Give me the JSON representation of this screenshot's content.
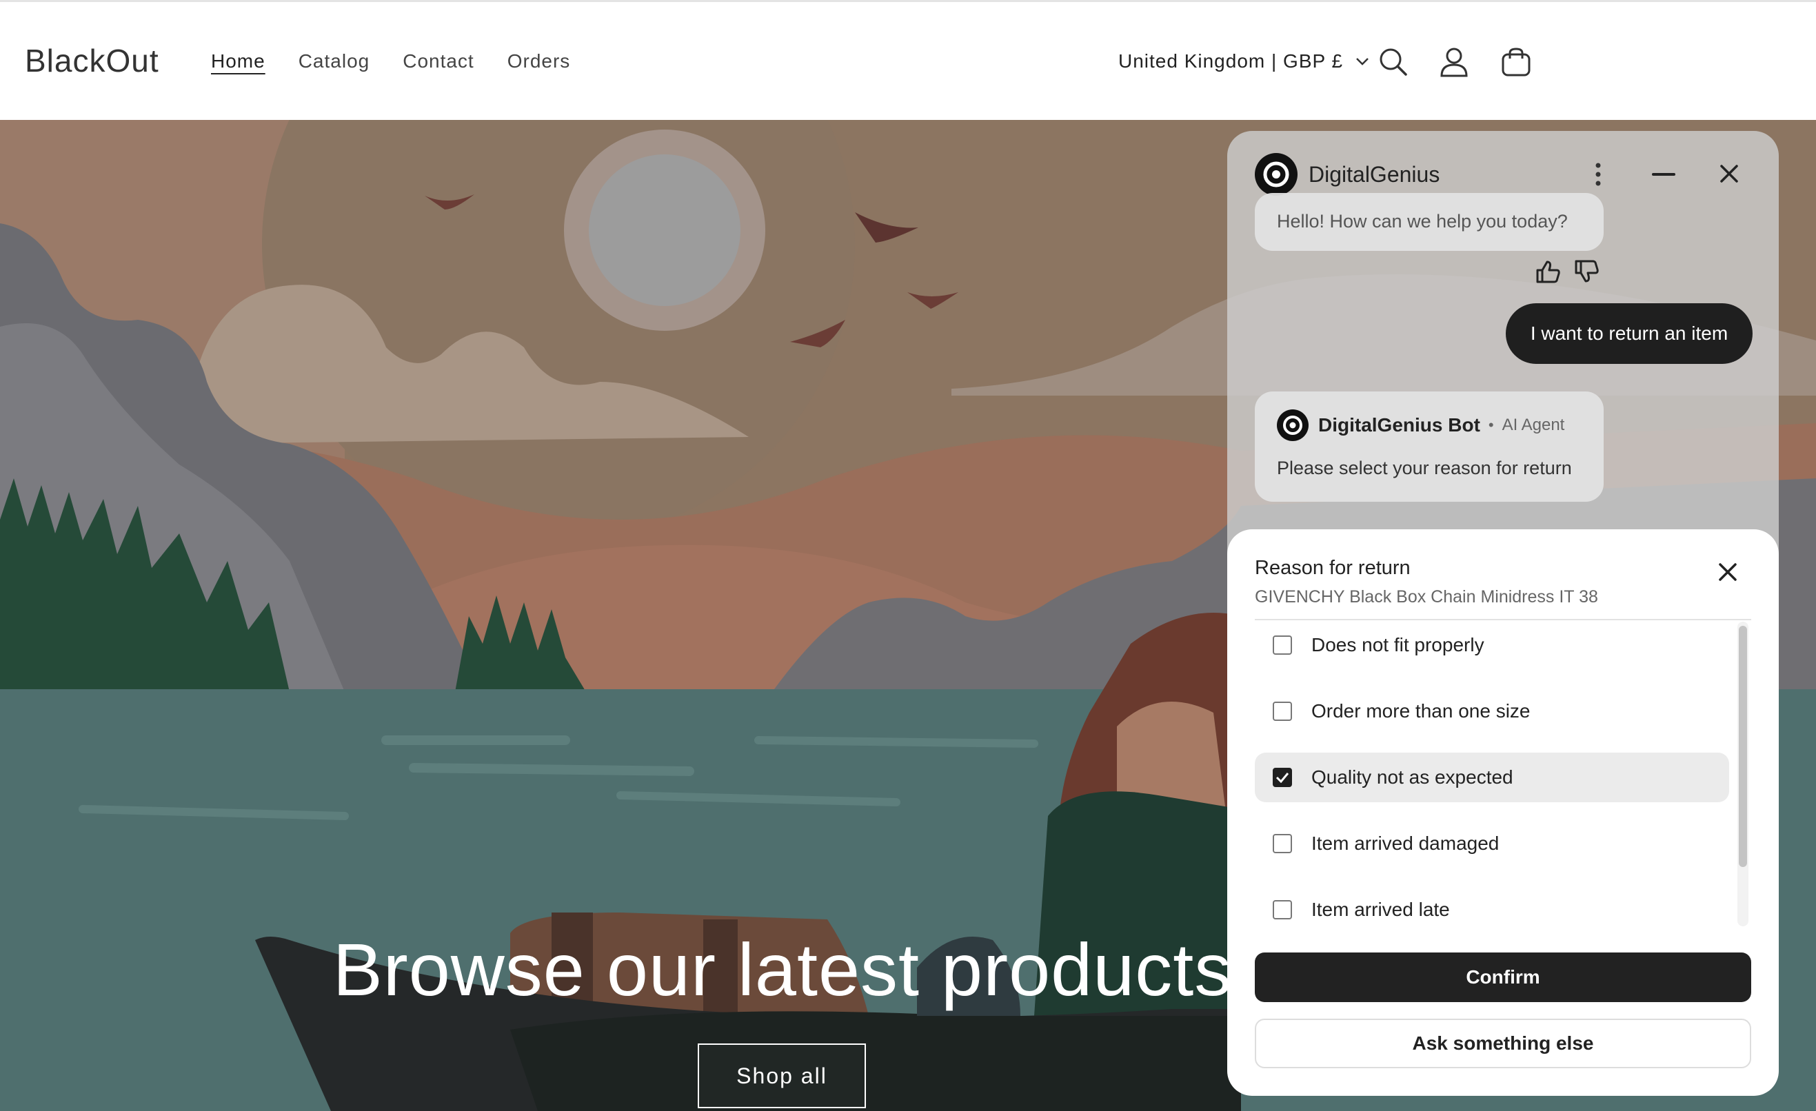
{
  "header": {
    "logo": "BlackOut",
    "nav": [
      {
        "label": "Home",
        "active": true
      },
      {
        "label": "Catalog",
        "active": false
      },
      {
        "label": "Contact",
        "active": false
      },
      {
        "label": "Orders",
        "active": false
      }
    ],
    "country_selector": "United Kingdom | GBP £",
    "icons": [
      "chevron-down-icon",
      "search-icon",
      "account-icon",
      "cart-icon"
    ]
  },
  "hero": {
    "title": "Browse our latest products",
    "button": "Shop all"
  },
  "chat": {
    "brand": "DigitalGenius",
    "greeting": "Hello! How can we help you today?",
    "user_message": "I want to return an item",
    "bot_name": "DigitalGenius Bot",
    "bot_separator": "•",
    "bot_role": "AI Agent",
    "bot_message": "Please select your reason for return",
    "icons": [
      "brand-logo-icon",
      "more-vertical-icon",
      "minimize-icon",
      "close-icon",
      "thumbs-up-icon",
      "thumbs-down-icon"
    ]
  },
  "reason_panel": {
    "title": "Reason for return",
    "product": "GIVENCHY Black Box Chain Minidress IT 38",
    "options": [
      {
        "label": "Does not fit properly",
        "checked": false
      },
      {
        "label": "Order more than one size",
        "checked": false
      },
      {
        "label": "Quality not as expected",
        "checked": true
      },
      {
        "label": "Item arrived damaged",
        "checked": false
      },
      {
        "label": "Item arrived late",
        "checked": false
      }
    ],
    "confirm": "Confirm",
    "ask_else": "Ask something else"
  },
  "colors": {
    "dark_button": "#222222",
    "chat_bg": "#cdcdcd",
    "water": "#4e6e6d",
    "sky": "#8a7462"
  }
}
